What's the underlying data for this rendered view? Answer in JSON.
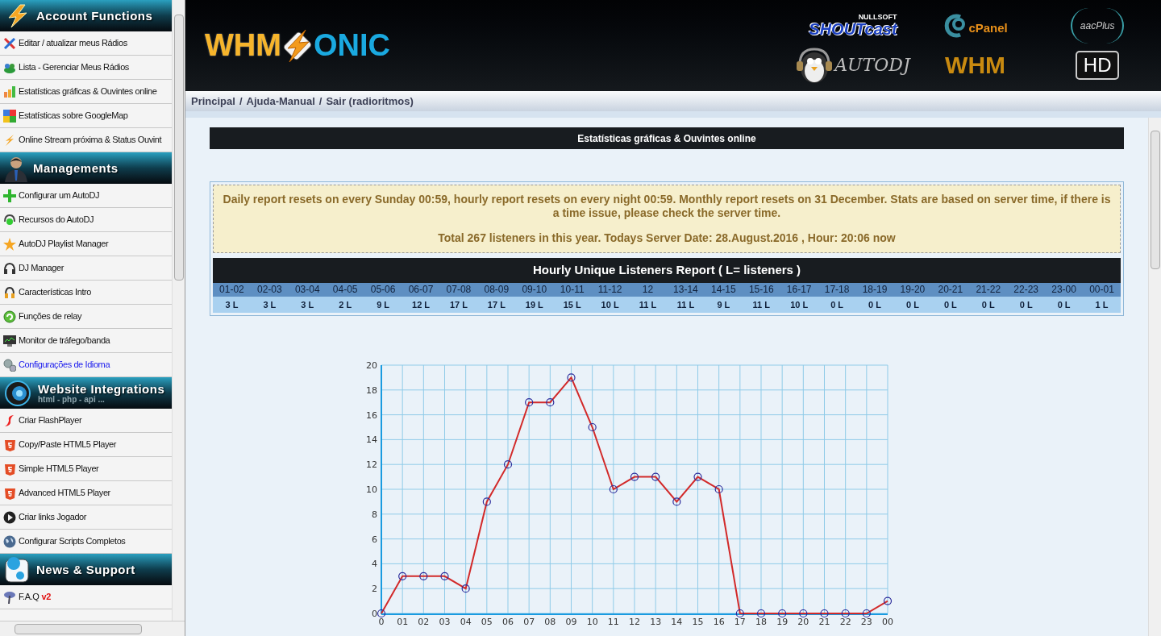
{
  "sidebar": {
    "sections": [
      {
        "title": "Account Functions",
        "items": [
          {
            "label": "Editar / atualizar meus Rádios",
            "selected": false
          },
          {
            "label": "Lista - Gerenciar Meus Rádios",
            "selected": false
          },
          {
            "label": "Estatísticas gráficas & Ouvintes online",
            "selected": false
          },
          {
            "label": "Estatísticas sobre GoogleMap",
            "selected": false
          },
          {
            "label": "Online Stream próxima & Status Ouvint",
            "selected": false
          }
        ]
      },
      {
        "title": "Managements",
        "items": [
          {
            "label": "Configurar um AutoDJ",
            "selected": false
          },
          {
            "label": "Recursos do AutoDJ",
            "selected": false
          },
          {
            "label": "AutoDJ Playlist Manager",
            "selected": false
          },
          {
            "label": "DJ Manager",
            "selected": false
          },
          {
            "label": "Características Intro",
            "selected": false
          },
          {
            "label": "Funções de relay",
            "selected": false
          },
          {
            "label": "Monitor de tráfego/banda",
            "selected": false
          },
          {
            "label": "Configurações de Idioma",
            "selected": true
          }
        ]
      },
      {
        "title": "Website Integrations",
        "subtitle": "html - php - api ...",
        "items": [
          {
            "label": "Criar FlashPlayer",
            "selected": false
          },
          {
            "label": "Copy/Paste HTML5 Player",
            "selected": false
          },
          {
            "label": "Simple HTML5 Player",
            "selected": false
          },
          {
            "label": "Advanced HTML5 Player",
            "selected": false
          },
          {
            "label": "Criar links Jogador",
            "selected": false
          },
          {
            "label": "Configurar Scripts Completos",
            "selected": false
          }
        ]
      },
      {
        "title": "News & Support",
        "items": [
          {
            "label": "F.A.Q",
            "badge": "v2",
            "selected": false
          }
        ]
      }
    ]
  },
  "header": {
    "logo": [
      "WHM",
      "ONIC"
    ],
    "partner_logos": [
      "NULLSOFT",
      "SHOUTcast",
      "cPanel",
      "aacPlus",
      "AUTODJ",
      "WHM",
      "HD"
    ]
  },
  "breadcrumb": [
    {
      "kind": "link",
      "text": "Principal"
    },
    {
      "kind": "separator",
      "text": "/"
    },
    {
      "kind": "link",
      "text": "Ajuda-Manual"
    },
    {
      "kind": "separator",
      "text": "/"
    },
    {
      "kind": "link",
      "text": "Sair (radioritmos)"
    }
  ],
  "page_title": "Estatísticas gráficas & Ouvintes online",
  "notice": {
    "lines": [
      "Daily report resets on every Sunday 00:59, hourly report resets on every night 00:59. Monthly report resets on 31 December. Stats are based on server time, if there is a time issue, please check the server time.",
      "Total 267 listeners in this year. Todays Server Date: 28.August.2016 , Hour: 20:06 now"
    ]
  },
  "report": {
    "title": "Hourly Unique Listeners Report ( L= listeners )",
    "hours": [
      "01-02",
      "02-03",
      "03-04",
      "04-05",
      "05-06",
      "06-07",
      "07-08",
      "08-09",
      "09-10",
      "10-11",
      "11-12",
      "12",
      "13-14",
      "14-15",
      "15-16",
      "16-17",
      "17-18",
      "18-19",
      "19-20",
      "20-21",
      "21-22",
      "22-23",
      "23-00",
      "00-01"
    ],
    "counts": [
      "3 L",
      "3 L",
      "3 L",
      "2 L",
      "9 L",
      "12 L",
      "17 L",
      "17 L",
      "19 L",
      "15 L",
      "10 L",
      "11 L",
      "11 L",
      "9 L",
      "11 L",
      "10 L",
      "0 L",
      "0 L",
      "0 L",
      "0 L",
      "0 L",
      "0 L",
      "0 L",
      "1 L"
    ]
  },
  "chart": {
    "chart_data": {
      "type": "line",
      "categories": [
        "0",
        "01",
        "02",
        "03",
        "04",
        "05",
        "06",
        "07",
        "08",
        "09",
        "10",
        "11",
        "12",
        "13",
        "14",
        "15",
        "16",
        "17",
        "18",
        "19",
        "20",
        "21",
        "22",
        "23",
        "00"
      ],
      "grid": true,
      "series": [
        {
          "color": "#d22a2a",
          "marker": "circle",
          "values": [
            0,
            3,
            3,
            3,
            2,
            9,
            12,
            17,
            17,
            19,
            15,
            10,
            11,
            11,
            9,
            11,
            10,
            0,
            0,
            0,
            0,
            0,
            0,
            0,
            1
          ]
        }
      ],
      "ylim": [
        0,
        20
      ],
      "yticks": [
        0,
        2,
        4,
        6,
        8,
        10,
        12,
        14,
        16,
        18,
        20
      ]
    }
  }
}
